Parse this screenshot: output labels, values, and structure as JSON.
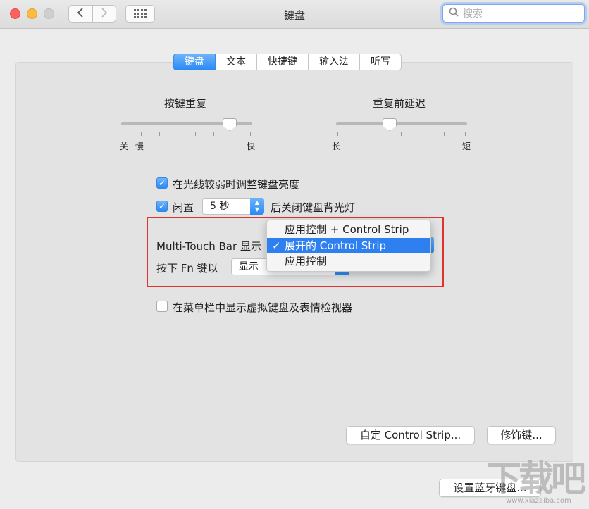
{
  "window": {
    "title": "键盘"
  },
  "search": {
    "placeholder": "搜索"
  },
  "tabs": [
    {
      "label": "键盘",
      "active": true
    },
    {
      "label": "文本"
    },
    {
      "label": "快捷键"
    },
    {
      "label": "输入法"
    },
    {
      "label": "听写"
    }
  ],
  "sliders": {
    "key_repeat": {
      "title": "按键重复",
      "min_label1": "关",
      "min_label2": "慢",
      "max_label": "快",
      "value_fraction": 0.8
    },
    "repeat_delay": {
      "title": "重复前延迟",
      "min_label": "长",
      "max_label": "短",
      "value_fraction": 0.4
    }
  },
  "options": {
    "adjust_brightness": {
      "label": "在光线较弱时调整键盘亮度",
      "checked": true
    },
    "idle_backlight": {
      "prefix": "闲置",
      "value": "5 秒",
      "suffix": "后关闭键盘背光灯",
      "checked": true
    },
    "touchbar_label": "Multi-Touch Bar 显示",
    "fn_label": "按下 Fn 键以",
    "fn_value": "显示",
    "show_viewer": {
      "label": "在菜单栏中显示虚拟键盘及表情检视器",
      "checked": false
    }
  },
  "dropdown_menu": {
    "items": [
      {
        "label": "应用控制 + Control Strip",
        "selected": false
      },
      {
        "label": "展开的 Control Strip",
        "selected": true
      },
      {
        "label": "应用控制",
        "selected": false
      }
    ],
    "check_glyph": "✓"
  },
  "buttons": {
    "customize": "自定 Control Strip...",
    "modifier": "修饰键...",
    "bluetooth": "设置蓝牙键盘..."
  },
  "watermark": {
    "text": "下载吧",
    "url": "www.xiazaiba.com"
  },
  "colors": {
    "accent": "#2e7ff0",
    "highlight_box": "#e0322f"
  }
}
